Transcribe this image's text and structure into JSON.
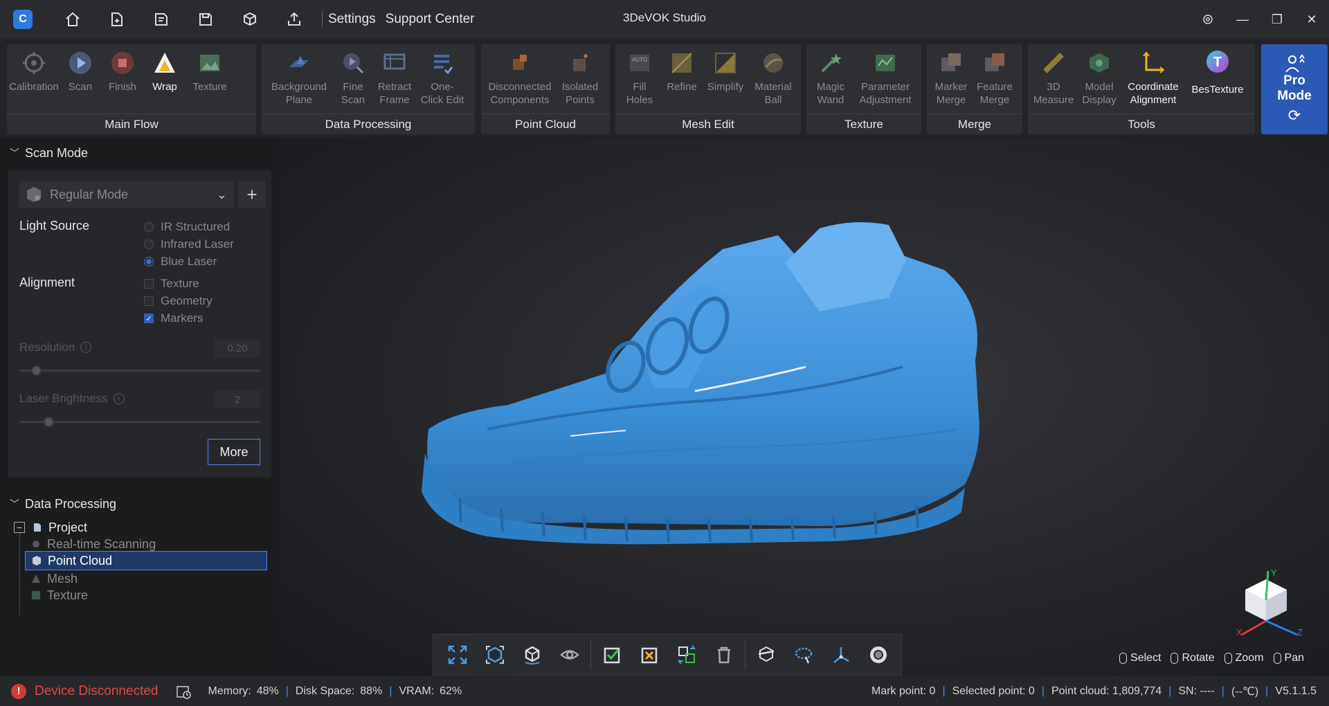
{
  "titlebar": {
    "app_title": "3DeVOK Studio",
    "settings": "Settings",
    "support": "Support Center",
    "icons": [
      "home-icon",
      "new-project-icon",
      "open-project-icon",
      "save-icon",
      "import-model-icon",
      "export-icon"
    ]
  },
  "ribbon": {
    "main_flow": {
      "label": "Main Flow",
      "items": [
        "Calibration",
        "Scan",
        "Finish",
        "Wrap",
        "Texture"
      ]
    },
    "data_processing": {
      "label": "Data Processing",
      "items": [
        "Background\nPlane",
        "Fine\nScan",
        "Retract\nFrame",
        "One-\nClick Edit"
      ]
    },
    "point_cloud": {
      "label": "Point Cloud",
      "items": [
        "Disconnected\nComponents",
        "Isolated\nPoints"
      ]
    },
    "mesh_edit": {
      "label": "Mesh Edit",
      "items": [
        "Fill\nHoles",
        "Refine",
        "Simplify",
        "Material\nBall"
      ]
    },
    "texture": {
      "label": "Texture",
      "items": [
        "Magic\nWand",
        "Parameter\nAdjustment"
      ]
    },
    "merge": {
      "label": "Merge",
      "items": [
        "Marker\nMerge",
        "Feature\nMerge"
      ]
    },
    "tools": {
      "label": "Tools",
      "items": [
        "3D\nMeasure",
        "Model\nDisplay",
        "Coordinate\nAlignment",
        "BesTexture"
      ]
    },
    "pro_mode": "Pro\nMode"
  },
  "scan_mode": {
    "header": "Scan Mode",
    "mode": "Regular Mode",
    "light_source_label": "Light Source",
    "light_options": [
      "IR Structured",
      "Infrared Laser",
      "Blue Laser"
    ],
    "light_selected": "Blue Laser",
    "alignment_label": "Alignment",
    "alignment_options": [
      "Texture",
      "Geometry",
      "Markers"
    ],
    "alignment_checked": "Markers",
    "resolution_label": "Resolution",
    "resolution_value": "0.20",
    "resolution_level": 0.05,
    "laser_label": "Laser Brightness",
    "laser_value": "2",
    "laser_level": 0.1,
    "more": "More"
  },
  "data_processing": {
    "header": "Data Processing",
    "tree": {
      "root": "Project",
      "children": [
        "Real-time Scanning",
        "Point Cloud",
        "Mesh",
        "Texture"
      ],
      "selected": "Point Cloud"
    }
  },
  "viewport": {
    "mouse_hints": [
      "Select",
      "Rotate",
      "Zoom",
      "Pan"
    ],
    "axes": [
      "X",
      "Y",
      "Z"
    ]
  },
  "status": {
    "device": "Device Disconnected",
    "memory_label": "Memory:",
    "memory": "48%",
    "disk_label": "Disk Space:",
    "disk": "88%",
    "vram_label": "VRAM:",
    "vram": "62%",
    "mark_point": "Mark point: 0",
    "selected_point": "Selected point: 0",
    "point_cloud": "Point cloud: 1,809,774",
    "sn": "SN: ----",
    "temp": "(--℃)",
    "version": "V5.1.1.5"
  },
  "colors": {
    "accent": "#2a5ab5",
    "model": "#3b8fd6",
    "error": "#e04a4a"
  }
}
